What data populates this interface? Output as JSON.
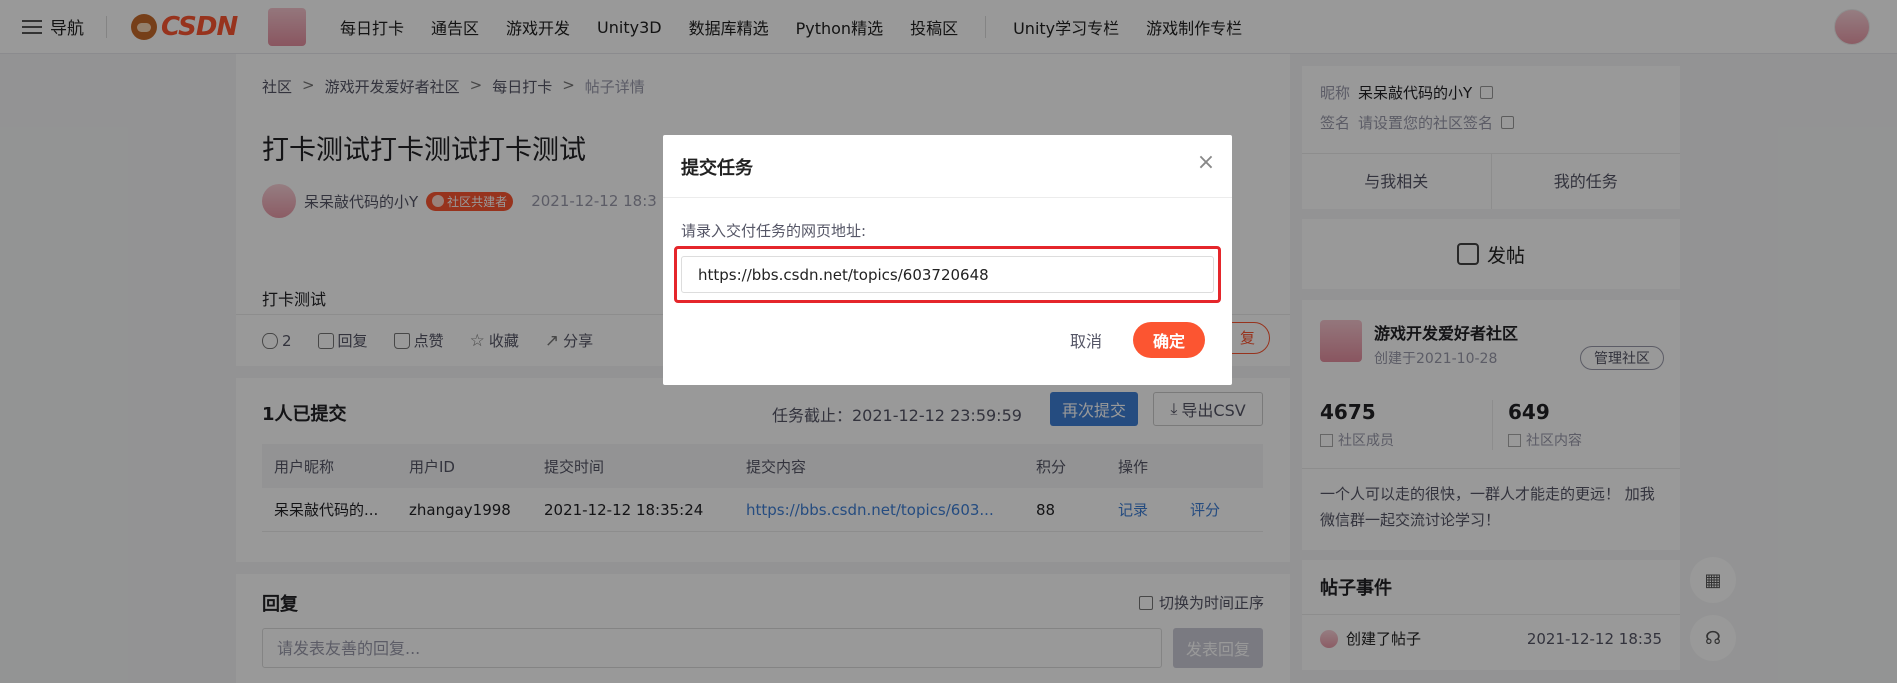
{
  "topbar": {
    "nav_label": "导航",
    "logo_text": "CSDN",
    "links": [
      "每日打卡",
      "通告区",
      "游戏开发",
      "Unity3D",
      "数据库精选",
      "Python精选",
      "投稿区"
    ],
    "links_right": [
      "Unity学习专栏",
      "游戏制作专栏"
    ]
  },
  "breadcrumb": [
    "社区",
    "游戏开发爱好者社区",
    "每日打卡",
    "帖子详情"
  ],
  "post": {
    "title": "打卡测试打卡测试打卡测试",
    "author": "呆呆敲代码的小Y",
    "author_badge": "社区共建者",
    "date": "2021-12-12 18:3",
    "body": "打卡测试"
  },
  "actions": {
    "views": "2",
    "reply": "回复",
    "like": "点赞",
    "favorite": "收藏",
    "share": "分享",
    "reply_pill": "复"
  },
  "submissions": {
    "count_label": "1人已提交",
    "deadline_label": "任务截止：2021-12-12 23:59:59",
    "resubmit_label": "再次提交",
    "export_label": "导出CSV",
    "columns": [
      "用户昵称",
      "用户ID",
      "提交时间",
      "提交内容",
      "积分",
      "操作"
    ],
    "rows": [
      {
        "nickname": "呆呆敲代码的...",
        "user_id": "zhangay1998",
        "time": "2021-12-12 18:35:24",
        "content": "https://bbs.csdn.net/topics/603...",
        "score": "88",
        "op_record": "记录",
        "op_rate": "评分"
      }
    ]
  },
  "reply_section": {
    "title": "回复",
    "sort_label": "切换为时间正序",
    "placeholder": "请发表友善的回复...",
    "submit_label": "发表回复"
  },
  "profile": {
    "nickname_label": "昵称",
    "nickname": "呆呆敲代码的小Y",
    "signature_label": "签名",
    "signature": "请设置您的社区签名",
    "tab_related": "与我相关",
    "tab_tasks": "我的任务"
  },
  "post_button": "发帖",
  "community": {
    "name": "游戏开发爱好者社区",
    "created": "创建于2021-10-28",
    "manage_label": "管理社区",
    "members_count": "4675",
    "members_label": "社区成员",
    "content_count": "649",
    "content_label": "社区内容",
    "description": "一个人可以走的很快，一群人才能走的更远！ 加我微信群一起交流讨论学习！"
  },
  "events": {
    "title": "帖子事件",
    "items": [
      {
        "label": "创建了帖子",
        "time": "2021-12-12 18:35"
      }
    ]
  },
  "modal": {
    "title": "提交任务",
    "field_label": "请录入交付任务的网页地址:",
    "url_value": "https://bbs.csdn.net/topics/603720648",
    "cancel_label": "取消",
    "confirm_label": "确定"
  },
  "colors": {
    "brand": "#fc5531",
    "primary_blue": "#3f7fd6",
    "highlight_red": "#e5262b"
  },
  "icons": [
    "menu-icon",
    "close-icon",
    "eye-icon",
    "comment-icon",
    "thumbs-up-icon",
    "star-icon",
    "share-icon",
    "download-icon",
    "edit-icon",
    "user-icon",
    "folder-icon",
    "qrcode-icon",
    "headset-icon"
  ]
}
